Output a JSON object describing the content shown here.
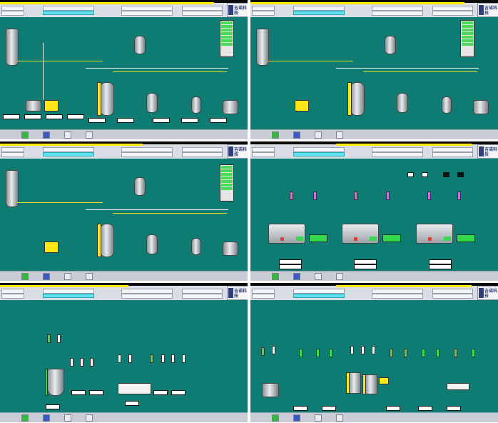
{
  "screen": {
    "brand_text": "吉诺科技",
    "panels": [
      {
        "id": "p1",
        "kind": "process-overview"
      },
      {
        "id": "p2",
        "kind": "process-overview"
      },
      {
        "id": "p3",
        "kind": "process-overview"
      },
      {
        "id": "p4",
        "kind": "compressors"
      },
      {
        "id": "p5",
        "kind": "tank-valves"
      },
      {
        "id": "p6",
        "kind": "valve-array"
      }
    ]
  },
  "colors": {
    "background": "#0f7c74",
    "header": "#d9dde6",
    "accent_yellow": "#ffea00",
    "accent_cyan": "#61e3ef",
    "status_green": "#3be04c",
    "alarm_red": "#d8443c",
    "indicator_magenta": "#d96ce1"
  },
  "icons": [
    "brand-logo-icon",
    "play-icon",
    "pause-icon",
    "lock-icon",
    "stop-icon"
  ]
}
